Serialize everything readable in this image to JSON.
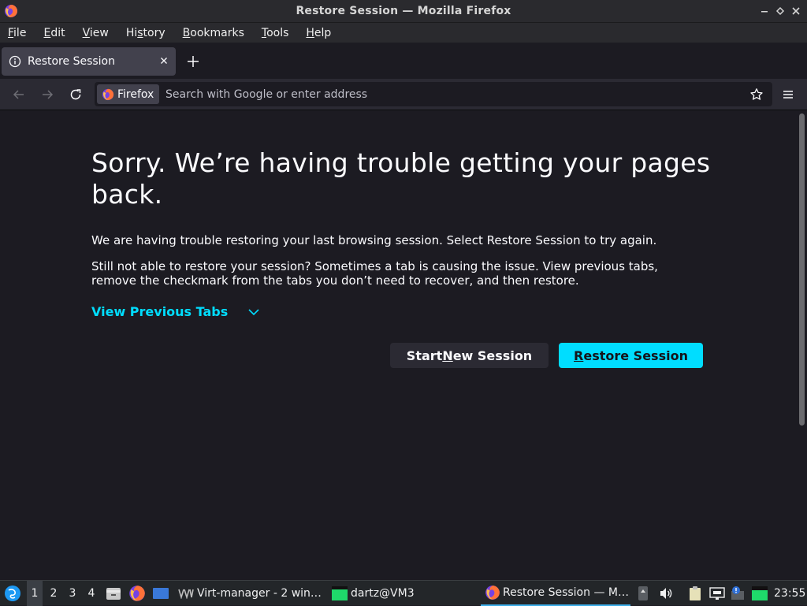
{
  "window": {
    "title": "Restore Session — Mozilla Firefox"
  },
  "menubar": {
    "items": [
      {
        "before": "",
        "accel": "F",
        "after": "ile"
      },
      {
        "before": "",
        "accel": "E",
        "after": "dit"
      },
      {
        "before": "",
        "accel": "V",
        "after": "iew"
      },
      {
        "before": "Hi",
        "accel": "s",
        "after": "tory"
      },
      {
        "before": "",
        "accel": "B",
        "after": "ookmarks"
      },
      {
        "before": "",
        "accel": "T",
        "after": "ools"
      },
      {
        "before": "",
        "accel": "H",
        "after": "elp"
      }
    ]
  },
  "tabs": [
    {
      "label": "Restore Session",
      "active": true
    }
  ],
  "navbar": {
    "identity_label": "Firefox",
    "url_placeholder": "Search with Google or enter address",
    "url_value": ""
  },
  "page": {
    "heading": "Sorry. We’re having trouble getting your pages back.",
    "para1": "We are having trouble restoring your last browsing session. Select Restore Session to try again.",
    "para2": "Still not able to restore your session? Sometimes a tab is causing the issue. View previous tabs, remove the checkmark from the tabs you don’t need to recover, and then restore.",
    "view_tabs_label": "View Previous Tabs",
    "start_new": {
      "before": "Start ",
      "accel": "N",
      "after": "ew Session"
    },
    "restore": {
      "before": "",
      "accel": "R",
      "after": "estore Session"
    }
  },
  "taskbar": {
    "workspaces": [
      "1",
      "2",
      "3",
      "4"
    ],
    "active_workspace": "1",
    "tasks": [
      {
        "label": "Virt-manager - 2 win…",
        "icon": "virt-manager-icon"
      },
      {
        "label": "dartz@VM3",
        "icon": "terminal-icon"
      },
      {
        "label": "Restore Session — M…",
        "icon": "firefox-icon",
        "active": true
      }
    ],
    "clock": "23:55"
  },
  "colors": {
    "accent": "#00ddff",
    "content_bg": "#1c1b22",
    "toolbar_bg": "#2b2a33",
    "tab_bg": "#42414d"
  }
}
